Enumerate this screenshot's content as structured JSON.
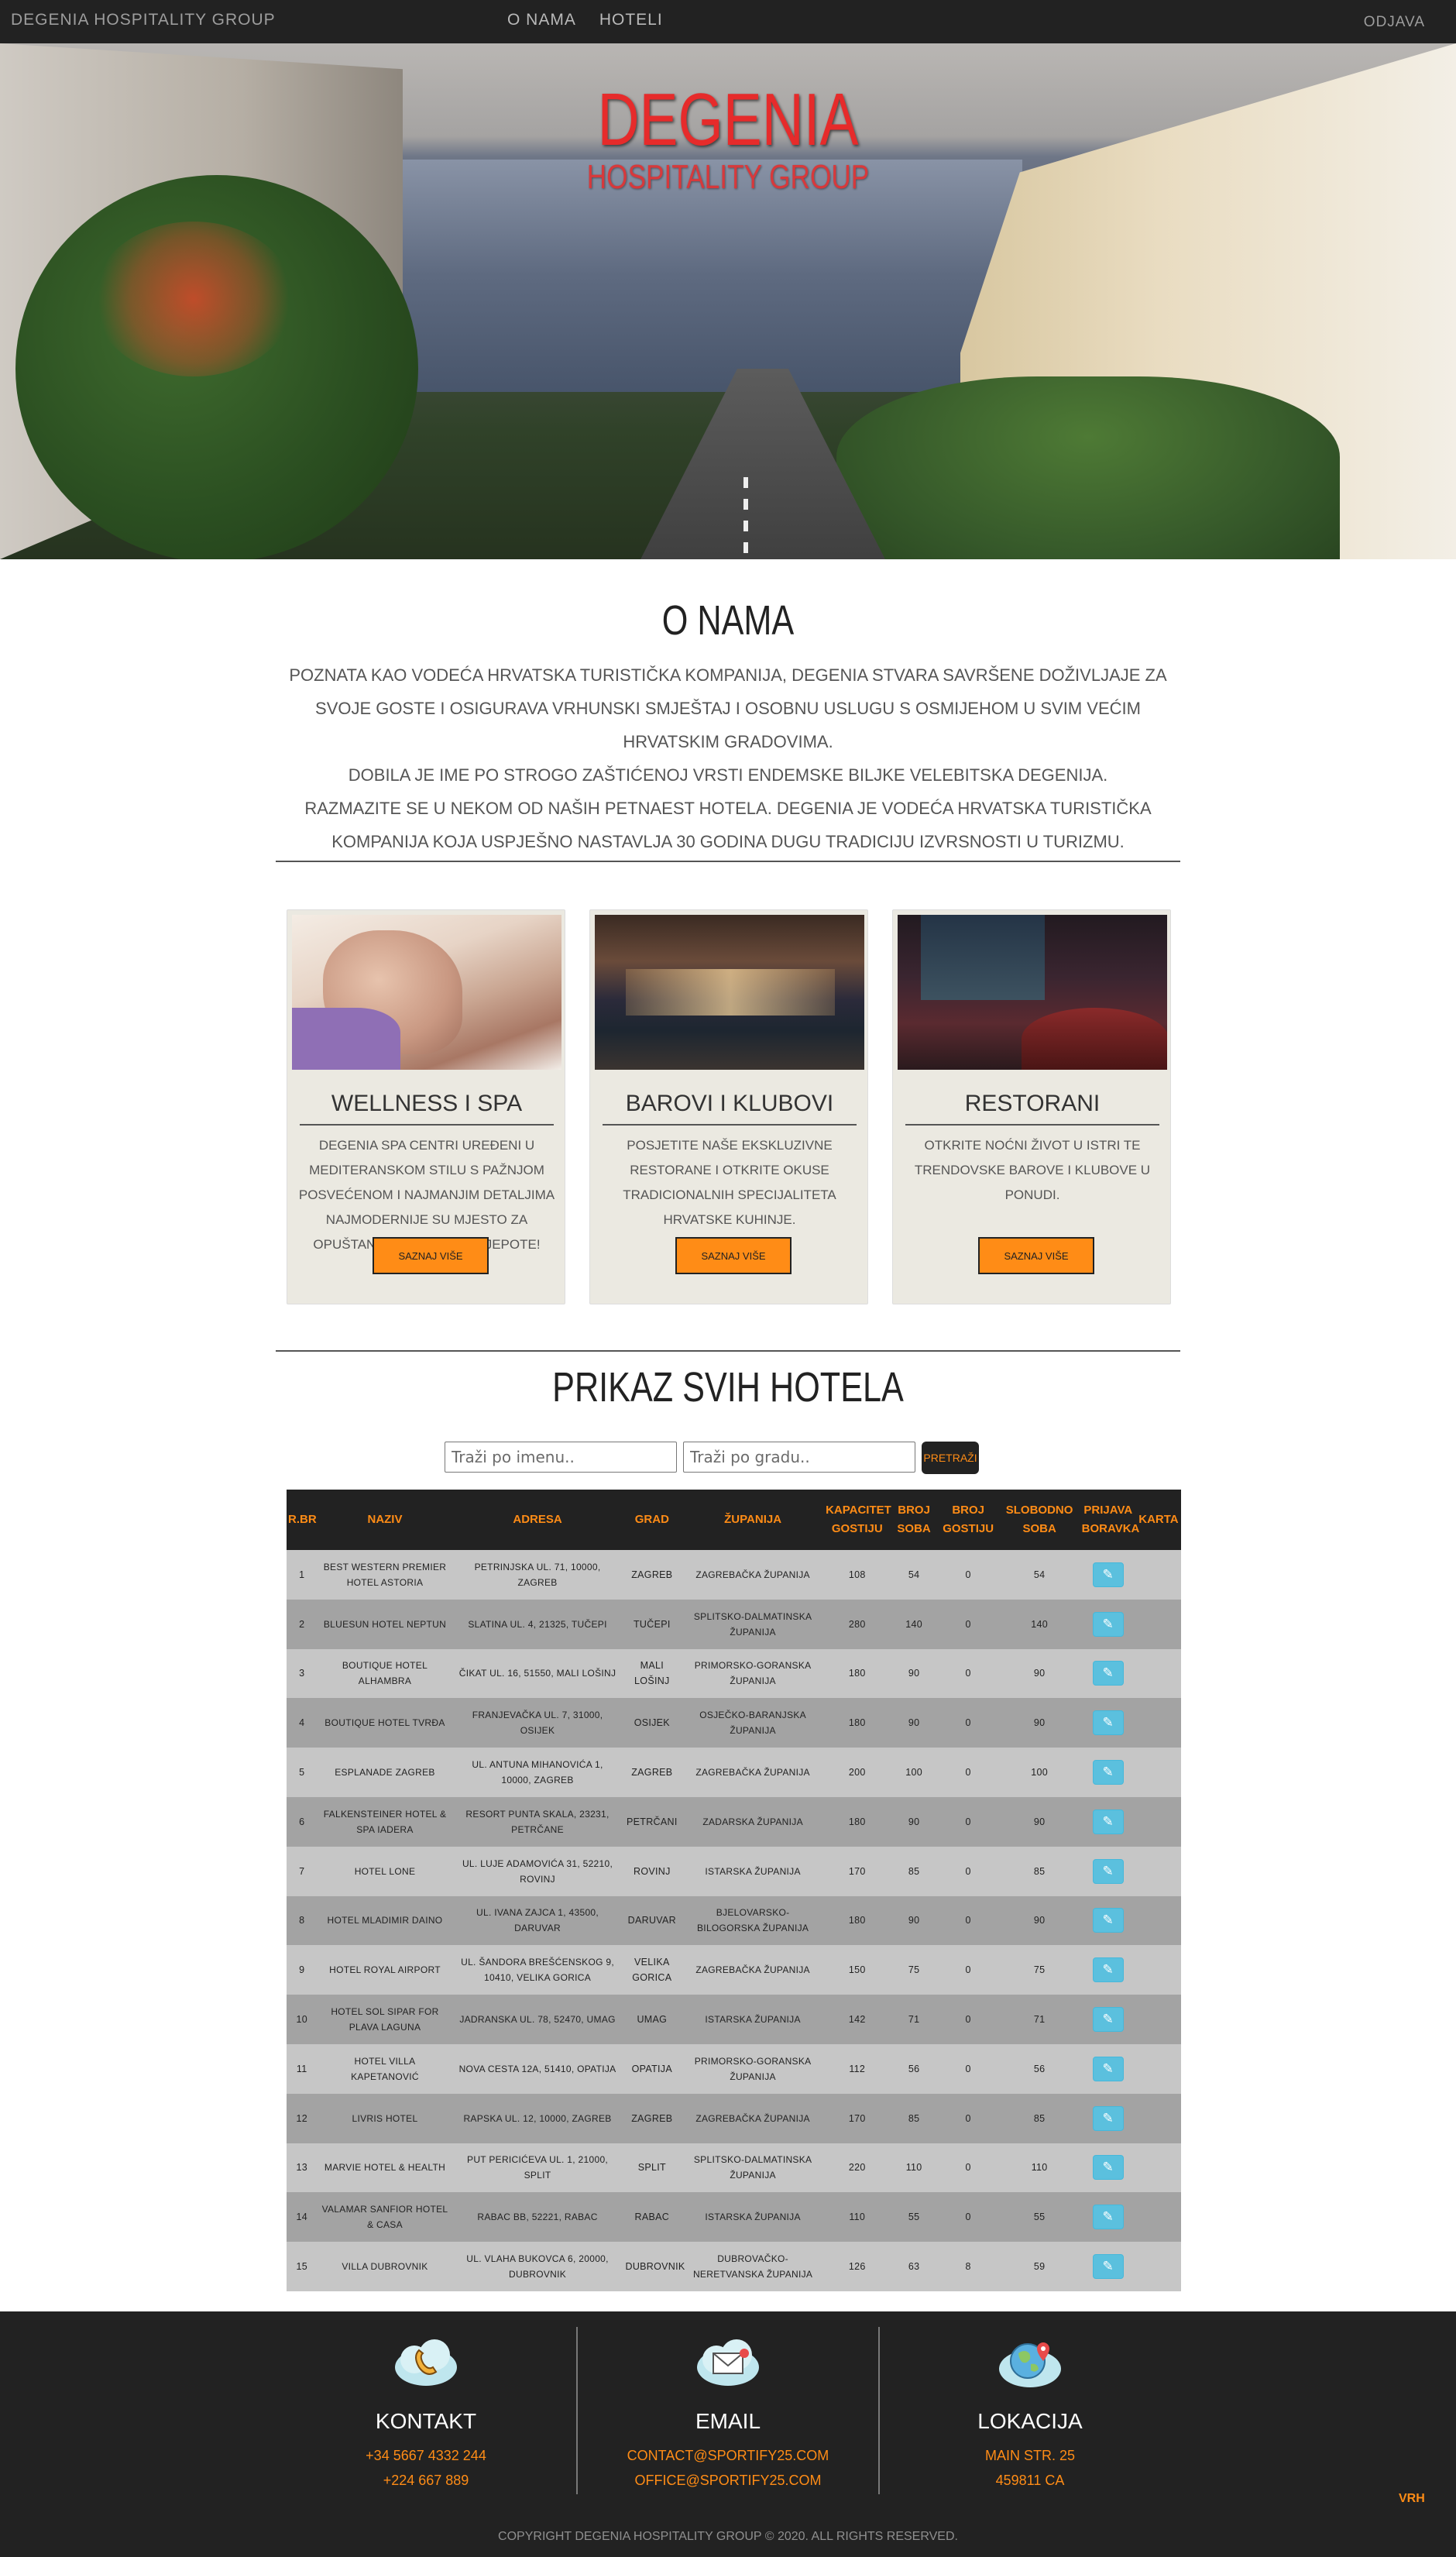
{
  "navbar": {
    "brand": "DEGENIA HOSPITALITY GROUP",
    "links": [
      "O NAMA",
      "HOTELI"
    ],
    "logout": "ODJAVA"
  },
  "hero": {
    "title": "DEGENIA",
    "subtitle": "HOSPITALITY GROUP"
  },
  "about": {
    "title": "O NAMA",
    "paragraphs": [
      "Poznata kao vodeća hrvatska turistička kompanija, Degenia stvara savršene doživljaje za svoje goste i osigurava vrhunski smještaj i osobnu uslugu s osmijehom u svim većim hrvatskim gradovima.",
      "Dobila je ime po strogo zaštićenoj vrsti endemske biljke velebitska degenija.",
      "Razmazite se u nekom od naših petnaest hotela. Degenia je vodeća hrvatska turistička kompanija koja uspješno nastavlja 30 godina dugu tradiciju izvrsnosti u turizmu."
    ]
  },
  "cards": [
    {
      "title": "WELLNESS I SPA",
      "description": "Degenia spa centri uređeni u mediteranskom stilu s pažnjom posvećenom i najmanjim detaljima najmodernije su mjesto za opuštanje i tretmane ljepote!",
      "button": "SAZNAJ VIŠE"
    },
    {
      "title": "BAROVI I KLUBOVI",
      "description": "Posjetite naše ekskluzivne restorane i otkrite okuse tradicionalnih specijaliteta hrvatske kuhinje.",
      "button": "SAZNAJ VIŠE"
    },
    {
      "title": "RESTORANI",
      "description": "Otkrite noćni život u Istri te trendovske barove i klubove u ponudi.",
      "button": "SAZNAJ VIŠE"
    }
  ],
  "hotels": {
    "title": "PRIKAZ SVIH HOTELA",
    "search_name_placeholder": "Traži po imenu..",
    "search_city_placeholder": "Traži po gradu..",
    "search_button": "PRETRAŽI",
    "columns": [
      "R.BR",
      "NAZIV",
      "ADRESA",
      "GRAD",
      "ŽUPANIJA",
      "KAPACITET GOSTIJU",
      "BROJ SOBA",
      "BROJ GOSTIJU",
      "SLOBODNO SOBA",
      "PRIJAVA BORAVKA",
      "KARTA"
    ],
    "edit_icon": "edit-icon",
    "rows": [
      [
        "1",
        "Best Western Premier Hotel Astoria",
        "Petrinjska ul. 71, 10000, Zagreb",
        "Zagreb",
        "Zagrebačka županija",
        "108",
        "54",
        "0",
        "54"
      ],
      [
        "2",
        "Bluesun hotel Neptun",
        "Slatina ul. 4, 21325, Tučepi",
        "Tučepi",
        "Splitsko-dalmatinska županija",
        "280",
        "140",
        "0",
        "140"
      ],
      [
        "3",
        "Boutique Hotel Alhambra",
        "Čikat ul. 16, 51550, Mali Lošinj",
        "Mali Lošinj",
        "Primorsko-goranska županija",
        "180",
        "90",
        "0",
        "90"
      ],
      [
        "4",
        "Boutique Hotel Tvrđa",
        "Franjevačka ul. 7, 31000, Osijek",
        "Osijek",
        "Osječko-baranjska županija",
        "180",
        "90",
        "0",
        "90"
      ],
      [
        "5",
        "Esplanade Zagreb",
        "Ul. Antuna Mihanovića 1, 10000, Zagreb",
        "Zagreb",
        "Zagrebačka županija",
        "200",
        "100",
        "0",
        "100"
      ],
      [
        "6",
        "Falkensteiner Hotel & Spa Iadera",
        "Resort Punta Skala, 23231, Petrčane",
        "Petrčani",
        "Zadarska županija",
        "180",
        "90",
        "0",
        "90"
      ],
      [
        "7",
        "Hotel Lone",
        "Ul. Luje Adamovića 31, 52210, Rovinj",
        "Rovinj",
        "Istarska županija",
        "170",
        "85",
        "0",
        "85"
      ],
      [
        "8",
        "Hotel Mladimir Daino",
        "Ul. Ivana Zajca 1, 43500, Daruvar",
        "Daruvar",
        "Bjelovarsko-bilogorska županija",
        "180",
        "90",
        "0",
        "90"
      ],
      [
        "9",
        "Hotel Royal Airport",
        "Ul. Šandora Brešćenskog 9, 10410, Velika Gorica",
        "Velika Gorica",
        "Zagrebačka županija",
        "150",
        "75",
        "0",
        "75"
      ],
      [
        "10",
        "Hotel Sol Sipar for Plava Laguna",
        "Jadranska ul. 78, 52470, Umag",
        "Umag",
        "Istarska županija",
        "142",
        "71",
        "0",
        "71"
      ],
      [
        "11",
        "Hotel Villa Kapetanović",
        "Nova cesta 12a, 51410, Opatija",
        "Opatija",
        "Primorsko-goranska županija",
        "112",
        "56",
        "0",
        "56"
      ],
      [
        "12",
        "Livris Hotel",
        "Rapska ul. 12, 10000, Zagreb",
        "Zagreb",
        "Zagrebačka županija",
        "170",
        "85",
        "0",
        "85"
      ],
      [
        "13",
        "Marvie Hotel & Health",
        "Put Pericićeva ul. 1, 21000, Split",
        "Split",
        "Splitsko-dalmatinska županija",
        "220",
        "110",
        "0",
        "110"
      ],
      [
        "14",
        "Valamar Sanfior Hotel & Casa",
        "Rabac bb, 52221, Rabac",
        "Rabac",
        "Istarska županija",
        "110",
        "55",
        "0",
        "55"
      ],
      [
        "15",
        "Villa Dubrovnik",
        "Ul. Vlaha Bukovca 6, 20000, Dubrovnik",
        "Dubrovnik",
        "Dubrovačko-neretvanska županija",
        "126",
        "63",
        "8",
        "59"
      ]
    ]
  },
  "footer": {
    "contact": {
      "title": "KONTAKT",
      "lines": [
        "+34 5667 4332 244",
        "+224 667 889"
      ],
      "icon": "phone-cloud-icon"
    },
    "email": {
      "title": "EMAIL",
      "lines": [
        "contact@sportify25.com",
        "office@sportify25.com"
      ],
      "icon": "email-cloud-icon"
    },
    "location": {
      "title": "LOKACIJA",
      "lines": [
        "Main Str. 25",
        "459811 CA"
      ],
      "icon": "globe-pin-icon"
    },
    "copyright": "COPYRIGHT DEGENIA HOSPITALITY GROUP © 2020. ALL RIGHTS RESERVED.",
    "back_to_top": "VRH"
  },
  "colors": {
    "accent": "#ff8c16",
    "hero_title": "#e62b2b",
    "navbar_bg": "#222222",
    "card_bg": "#ebe9e1",
    "edit_button": "#5bc0de"
  }
}
